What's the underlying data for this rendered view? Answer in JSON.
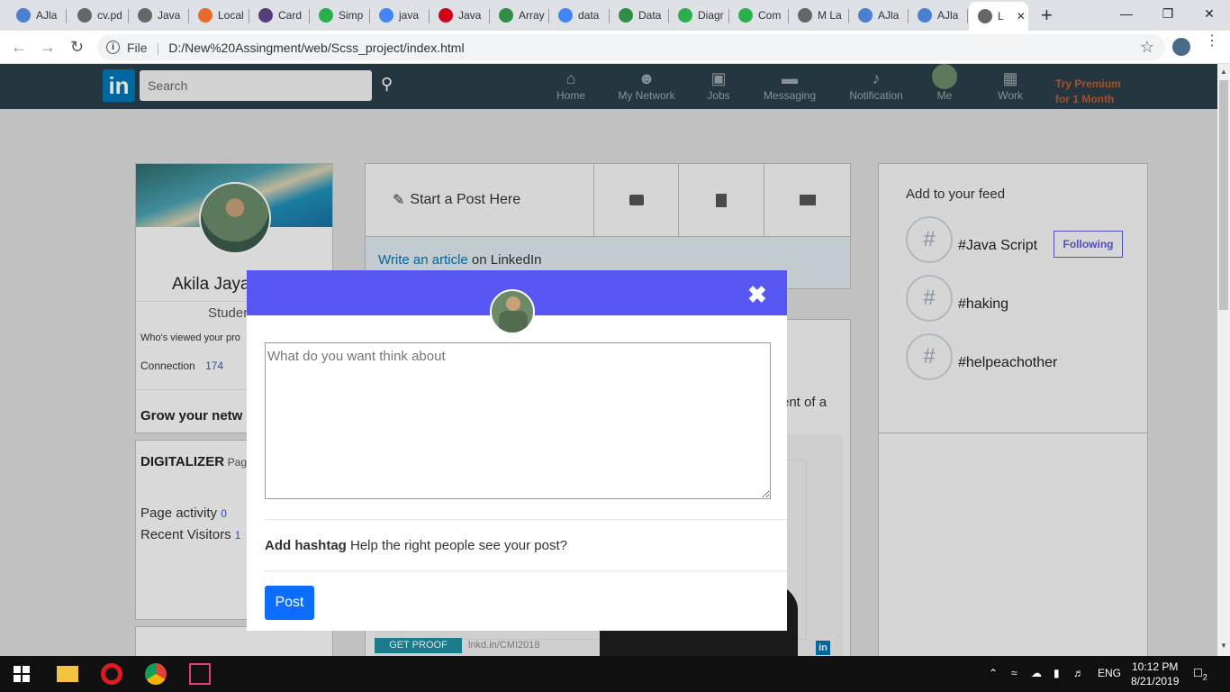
{
  "browser": {
    "tabs": [
      {
        "label": "AJla",
        "icon_color": "#4a7fd1"
      },
      {
        "label": "cv.pd",
        "icon_color": "#666666"
      },
      {
        "label": "Java",
        "icon_color": "#666666"
      },
      {
        "label": "Local",
        "icon_color": "#e66a2c"
      },
      {
        "label": "Card",
        "icon_color": "#563d7c"
      },
      {
        "label": "Simp",
        "icon_color": "#2ab04a"
      },
      {
        "label": "java",
        "icon_color": "#4285f4"
      },
      {
        "label": "Java",
        "icon_color": "#d0021b"
      },
      {
        "label": "Array",
        "icon_color": "#2f8d46"
      },
      {
        "label": "data",
        "icon_color": "#4285f4"
      },
      {
        "label": "Data",
        "icon_color": "#2f8d46"
      },
      {
        "label": "Diagr",
        "icon_color": "#2ab04a"
      },
      {
        "label": "Com",
        "icon_color": "#2ab04a"
      },
      {
        "label": "M La",
        "icon_color": "#666666"
      },
      {
        "label": "AJla",
        "icon_color": "#4a7fd1"
      },
      {
        "label": "AJla",
        "icon_color": "#4a7fd1"
      },
      {
        "label": "L",
        "icon_color": "#666666"
      }
    ],
    "new_tab": "+",
    "file_label": "File",
    "url": "D:/New%20Assingment/web/Scss_project/index.html"
  },
  "navbar": {
    "logo": "in",
    "search_placeholder": "Search",
    "items": [
      {
        "label": "Home",
        "icon": "home-icon"
      },
      {
        "label": "My Network",
        "icon": "network-icon"
      },
      {
        "label": "Jobs",
        "icon": "briefcase-icon"
      },
      {
        "label": "Messaging",
        "icon": "chat-icon"
      },
      {
        "label": "Notification",
        "icon": "bell-icon"
      },
      {
        "label": "Me",
        "icon": "avatar"
      },
      {
        "label": "Work",
        "icon": "grid-icon"
      }
    ],
    "premium_line1": "Try Premium",
    "premium_line2": "for 1 Month"
  },
  "profile": {
    "name": "Akila Jaya",
    "title": "Studen",
    "viewed": "Who's viewed your pro",
    "connection_label": "Connection",
    "connection_count": "174",
    "grow": "Grow your netw"
  },
  "page_card": {
    "name": "DIGITALIZER",
    "suffix": "Pag",
    "activity_label": "Page activity",
    "activity_value": "0",
    "visitors_label": "Recent Visitors",
    "visitors_value": "1"
  },
  "post_box": {
    "start_post": "Start a Post Here",
    "write_article_link": "Write an article",
    "write_article_rest": " on LinkedIn"
  },
  "feed": {
    "fragment": "ent of a",
    "ad_button": "GET PROOF",
    "ad_link": "lnkd.in/CMI2018",
    "ad_logo": "in"
  },
  "add_feed": {
    "title": "Add to your feed",
    "items": [
      {
        "tag": "#Java Script",
        "button": "Following"
      },
      {
        "tag": "#haking"
      },
      {
        "tag": "#helpeachother"
      }
    ],
    "hash_symbol": "#"
  },
  "modal": {
    "placeholder": "What do you want think about",
    "hashtag_bold": "Add hashtag",
    "hashtag_text": " Help the right people see your post?",
    "post_button": "Post",
    "close": "✖"
  },
  "taskbar": {
    "lang": "ENG",
    "time": "10:12 PM",
    "date": "8/21/2019",
    "notifications": "2"
  },
  "colors": {
    "navbar": "#293e49",
    "modal_header": "#5656f2",
    "post_button": "#0d6efd",
    "linkedin_blue": "#0077b5"
  }
}
